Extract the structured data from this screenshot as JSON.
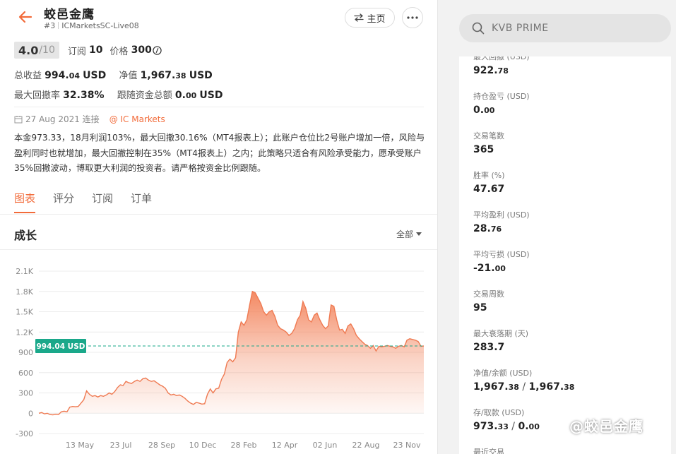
{
  "header": {
    "title": "蛟邑金鹰",
    "rank": "#3",
    "account": "ICMarketsSC-Live08",
    "home_label": "主页"
  },
  "summary": {
    "rating": "4.0",
    "rating_max": "/10",
    "subscriptions_label": "订阅",
    "subscriptions_value": "10",
    "price_label": "价格",
    "price_value": "300",
    "total_profit_label": "总收益",
    "total_profit_int": "994.",
    "total_profit_dec": "04",
    "total_profit_unit": "USD",
    "equity_label": "净值",
    "equity_int": "1,967.",
    "equity_dec": "38",
    "equity_unit": "USD",
    "max_drawdown_label": "最大回撤率",
    "max_drawdown_value": "32.38%",
    "follow_funds_label": "跟随资金总额",
    "follow_funds_int": "0.",
    "follow_funds_dec": "00",
    "follow_funds_unit": "USD",
    "connected_date": "27 Aug 2021 连接",
    "broker": "@ IC Markets"
  },
  "description": "本金973.33，18月利润103%，最大回撤30.16%（MT4报表上）；此账户仓位比2号账户增加一倍，风险与盈利同时也就增加，最大回撤控制在35%（MT4报表上）之内；此策略只适合有风险承受能力，愿承受账户35%回撤波动，博取更大利润的投资者。请严格按资金比例跟随。",
  "tabs": [
    "图表",
    "评分",
    "订阅",
    "订单"
  ],
  "section": {
    "title": "成长",
    "range_label": "全部"
  },
  "search": {
    "placeholder": "KVB PRIME"
  },
  "stats": [
    {
      "label": "最大回撤 (USD)",
      "int": "922.",
      "dec": "78"
    },
    {
      "label": "持仓盈亏 (USD)",
      "int": "0.",
      "dec": "00"
    },
    {
      "label": "交易笔数",
      "int": "365",
      "dec": ""
    },
    {
      "label": "胜率 (%)",
      "int": "47.67",
      "dec": ""
    },
    {
      "label": "平均盈利 (USD)",
      "int": "28.",
      "dec": "76"
    },
    {
      "label": "平均亏损 (USD)",
      "int": "-21.",
      "dec": "00"
    },
    {
      "label": "交易周数",
      "int": "95",
      "dec": ""
    },
    {
      "label": "最大衰落期 (天)",
      "int": "283.7",
      "dec": ""
    },
    {
      "label": "净值/余额 (USD)",
      "int": "1,967.",
      "dec": "38",
      "int2": "1,967.",
      "dec2": "38"
    },
    {
      "label": "存/取款 (USD)",
      "int": "973.",
      "dec": "33",
      "int2": "0.",
      "dec2": "00"
    },
    {
      "label": "最近交易",
      "int": "",
      "dec": ""
    }
  ],
  "watermark": "@蛟邑金鹰",
  "colors": {
    "accent": "#f26b3a",
    "current_badge": "#1aa88a",
    "area_top": "#f3845c",
    "line": "#ef7a52"
  },
  "chart_data": {
    "type": "area",
    "ylim": [
      -300,
      2100
    ],
    "yticks": [
      -300,
      0,
      300,
      600,
      900,
      1200,
      1500,
      1800,
      2100
    ],
    "ytick_labels": [
      "-300",
      "0",
      "300",
      "600",
      "900",
      "1.2K",
      "1.5K",
      "1.8K",
      "2.1K"
    ],
    "xtick_labels": [
      "13 May",
      "23 Jul",
      "28 Sep",
      "10 Dec",
      "28 Feb",
      "12 Apr",
      "02 Jun",
      "22 Aug",
      "23 Nov"
    ],
    "current_value": 994.04,
    "current_label": "994.04 USD",
    "series": [
      {
        "values": [
          0,
          10,
          -10,
          0,
          -20,
          -25,
          -15,
          -20,
          20,
          30,
          20,
          90,
          100,
          95,
          100,
          150,
          200,
          330,
          280,
          250,
          260,
          240,
          260,
          250,
          270,
          300,
          280,
          320,
          380,
          420,
          410,
          470,
          450,
          440,
          470,
          490,
          470,
          510,
          520,
          490,
          470,
          480,
          450,
          420,
          400,
          370,
          300,
          270,
          280,
          260,
          270,
          250,
          220,
          180,
          150,
          130,
          160,
          150,
          135,
          140,
          280,
          360,
          300,
          360,
          370,
          500,
          580,
          750,
          800,
          760,
          820,
          1200,
          1350,
          1300,
          1380,
          1600,
          1800,
          1780,
          1700,
          1620,
          1500,
          1450,
          1500,
          1520,
          1430,
          1300,
          1250,
          1230,
          1200,
          1150,
          1180,
          1250,
          1380,
          1450,
          1650,
          1550,
          1380,
          1350,
          1450,
          1480,
          1380,
          1300,
          1250,
          1290,
          1600,
          1580,
          1380,
          1230,
          1240,
          1180,
          1290,
          1320,
          1250,
          1150,
          1100,
          1060,
          1020,
          1000,
          960,
          1000,
          920,
          990,
          980,
          990,
          1000,
          990,
          980,
          960,
          990,
          1000,
          980,
          1080,
          1100,
          1090,
          1080,
          1060,
          990,
          994.04
        ]
      }
    ]
  }
}
